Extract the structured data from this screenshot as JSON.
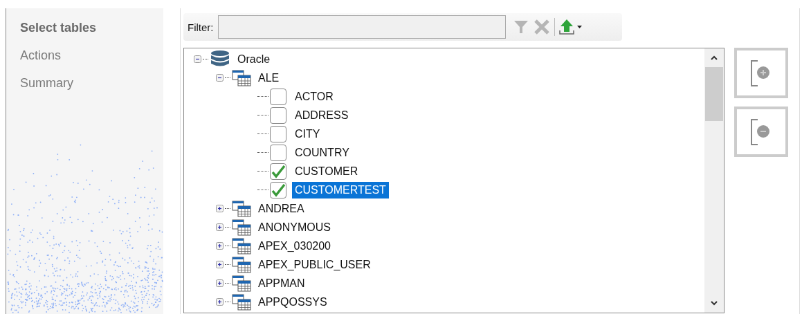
{
  "nav": [
    {
      "label": "Select tables",
      "selected": true
    },
    {
      "label": "Actions",
      "selected": false
    },
    {
      "label": "Summary",
      "selected": false
    }
  ],
  "filter": {
    "label": "Filter:"
  },
  "tree": [
    {
      "kind": "database",
      "label": "Oracle",
      "expanded": true,
      "selected": false,
      "children": [
        {
          "kind": "schema",
          "label": "ALE",
          "expanded": true,
          "selected": false,
          "children": [
            {
              "kind": "table",
              "label": "ACTOR",
              "checked": false,
              "selected": false
            },
            {
              "kind": "table",
              "label": "ADDRESS",
              "checked": false,
              "selected": false
            },
            {
              "kind": "table",
              "label": "CITY",
              "checked": false,
              "selected": false
            },
            {
              "kind": "table",
              "label": "COUNTRY",
              "checked": false,
              "selected": false
            },
            {
              "kind": "table",
              "label": "CUSTOMER",
              "checked": true,
              "selected": false
            },
            {
              "kind": "table",
              "label": "CUSTOMERTEST",
              "checked": true,
              "selected": true
            }
          ]
        },
        {
          "kind": "schema",
          "label": "ANDREA",
          "expanded": false,
          "selected": false
        },
        {
          "kind": "schema",
          "label": "ANONYMOUS",
          "expanded": false,
          "selected": false
        },
        {
          "kind": "schema",
          "label": "APEX_030200",
          "expanded": false,
          "selected": false
        },
        {
          "kind": "schema",
          "label": "APEX_PUBLIC_USER",
          "expanded": false,
          "selected": false
        },
        {
          "kind": "schema",
          "label": "APPMAN",
          "expanded": false,
          "selected": false
        },
        {
          "kind": "schema",
          "label": "APPQOSSYS",
          "expanded": false,
          "selected": false
        }
      ]
    }
  ]
}
